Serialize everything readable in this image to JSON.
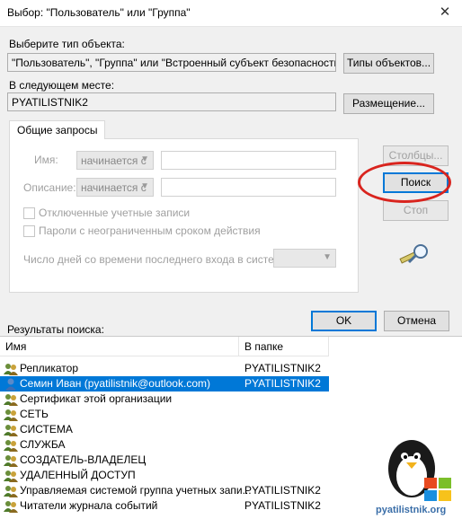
{
  "window": {
    "title": "Выбор: \"Пользователь\" или \"Группа\"",
    "close_glyph": "✕"
  },
  "object_type": {
    "label": "Выберите тип объекта:",
    "value": "\"Пользователь\", \"Группа\" или \"Встроенный субъект безопасности\"",
    "button": "Типы объектов..."
  },
  "location": {
    "label": "В следующем месте:",
    "value": "PYATILISTNIK2",
    "button": "Размещение..."
  },
  "query": {
    "tab": "Общие запросы",
    "name_label": "Имя:",
    "name_combo": "начинается с",
    "description_label": "Описание:",
    "description_combo": "начинается с",
    "disabled_accounts": "Отключенные учетные записи",
    "non_expiring_passwords": "Пароли с неограниченным сроком действия",
    "days_label": "Число дней со времени последнего входа в систему:",
    "columns_button": "Столбцы...",
    "search_button": "Поиск",
    "stop_button": "Стоп",
    "search_icon": "search-key-icon"
  },
  "dialog": {
    "ok": "OK",
    "cancel": "Отмена"
  },
  "results": {
    "label": "Результаты поиска:",
    "columns": [
      "Имя",
      "В папке"
    ],
    "rows": [
      {
        "icon": "group-icon",
        "name": "Репликатор",
        "folder": "PYATILISTNIK2",
        "selected": false
      },
      {
        "icon": "user-icon",
        "name": "Семин Иван (pyatilistnik@outlook.com)",
        "folder": "PYATILISTNIK2",
        "selected": true
      },
      {
        "icon": "group-icon",
        "name": "Сертификат этой организации",
        "folder": "",
        "selected": false
      },
      {
        "icon": "group-icon",
        "name": "СЕТЬ",
        "folder": "",
        "selected": false
      },
      {
        "icon": "group-icon",
        "name": "СИСТЕМА",
        "folder": "",
        "selected": false
      },
      {
        "icon": "group-icon",
        "name": "СЛУЖБА",
        "folder": "",
        "selected": false
      },
      {
        "icon": "group-icon",
        "name": "СОЗДАТЕЛЬ-ВЛАДЕЛЕЦ",
        "folder": "",
        "selected": false
      },
      {
        "icon": "group-icon",
        "name": "УДАЛЕННЫЙ ДОСТУП",
        "folder": "",
        "selected": false
      },
      {
        "icon": "group-icon",
        "name": "Управляемая системой группа учетных запи...",
        "folder": "PYATILISTNIK2",
        "selected": false
      },
      {
        "icon": "group-icon",
        "name": "Читатели журнала событий",
        "folder": "PYATILISTNIK2",
        "selected": false
      }
    ]
  },
  "watermark": {
    "text": "pyatilistnik.org"
  },
  "colors": {
    "selection": "#0078d7",
    "highlight_ellipse": "#d9241e"
  }
}
